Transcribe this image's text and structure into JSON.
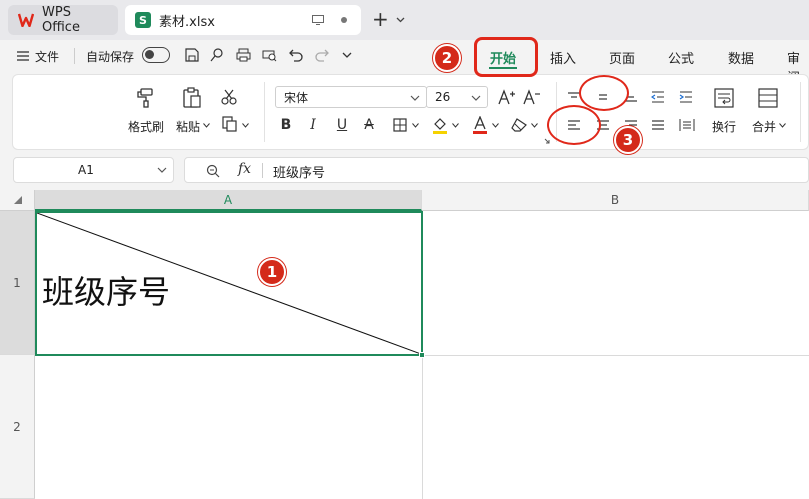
{
  "window": {
    "app_tab_label": "WPS Office",
    "file_tab_label": "素材.xlsx",
    "new_tab_symbol": "+"
  },
  "quickbar": {
    "file_label": "文件",
    "autosave_label": "自动保存"
  },
  "menu_tabs": [
    "开始",
    "插入",
    "页面",
    "公式",
    "数据",
    "审阅"
  ],
  "ribbon": {
    "format_painter_label": "格式刷",
    "paste_label": "粘贴",
    "font_name": "宋体",
    "font_size": "26",
    "wrap_label": "换行",
    "merge_label": "合并"
  },
  "formula_bar": {
    "cell_ref": "A1",
    "fx_label": "fx",
    "content": "班级序号"
  },
  "grid": {
    "columns": [
      "A",
      "B"
    ],
    "rows": [
      "1",
      "2"
    ],
    "cell_a1": "班级序号"
  },
  "annotations": {
    "step1": "1",
    "step2": "2",
    "step3": "3"
  },
  "colors": {
    "accent_green": "#1f8a5b",
    "annotation_red": "#d42a1a"
  }
}
